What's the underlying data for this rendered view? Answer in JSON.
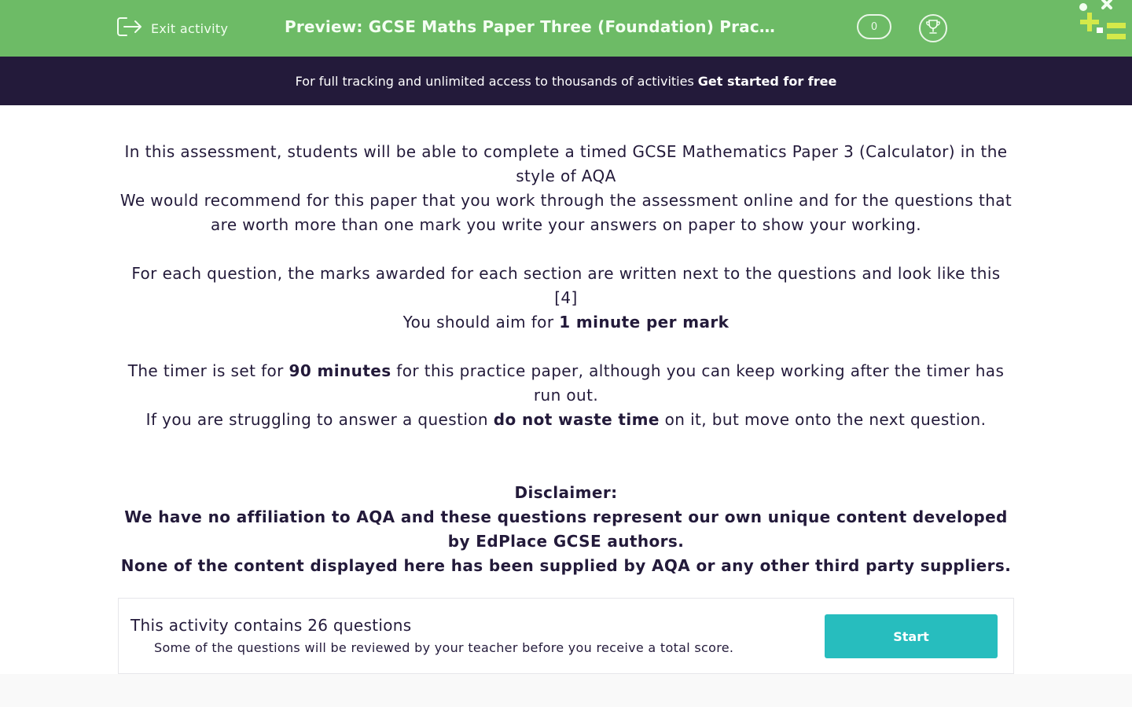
{
  "header": {
    "exit_label": "Exit activity",
    "title": "Preview: GCSE Maths Paper Three (Foundation) Practice Paper",
    "score": "0",
    "bg_color": "#6dbb66"
  },
  "banner": {
    "text": "For full tracking and unlimited access to thousands of activities",
    "cta": "Get started for free",
    "bg_color": "#231a3a"
  },
  "intro": {
    "p1": "In this assessment, students will be able to complete a timed GCSE Mathematics Paper 3 (Calculator) in the style of AQA",
    "p2": "We would recommend for this paper that you work through the assessment online and for the questions that are worth more than one mark you write your answers on paper to show your working.",
    "p3": "For each question, the marks awarded for each section are written next to the questions and look like this [4]",
    "p4_pre": "You should aim for ",
    "p4_bold": "1 minute per mark",
    "p5_pre": "The timer is set for ",
    "p5_bold": "90 minutes",
    "p5_post": " for this practice paper, although you can keep working after the timer has run out.",
    "p6_pre": "If you are struggling to answer a question ",
    "p6_bold": "do not waste time",
    "p6_post": " on it, but move onto the next question.",
    "disclaimer_title": "Disclaimer:",
    "disclaimer_1": "We have no affiliation to AQA and these questions represent our own unique content developed by EdPlace GCSE authors.",
    "disclaimer_2": "None of the content displayed here has been supplied by AQA or any other third party suppliers."
  },
  "card": {
    "title": "This activity contains 26 questions",
    "subtitle": "Some of the questions will be reviewed by your teacher before you receive a total score.",
    "start_label": "Start",
    "start_color": "#27bdbe"
  },
  "icons": {
    "exit": "exit-icon",
    "trophy": "trophy-icon",
    "logo": "edplace-logo"
  }
}
